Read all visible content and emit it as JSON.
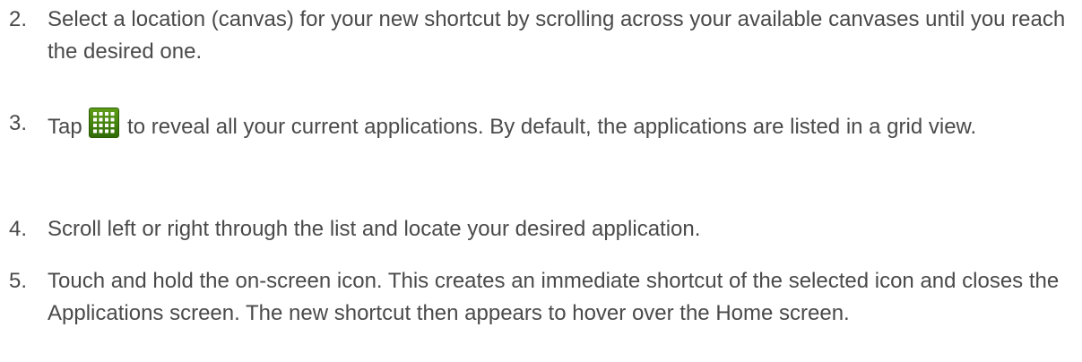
{
  "steps": [
    {
      "number": "2.",
      "text": "Select a location (canvas) for your new shortcut by scrolling across your available canvases until you reach the desired one."
    },
    {
      "number": "3.",
      "text_before": "Tap",
      "icon": "apps-grid-icon",
      "text_after": "to reveal all your current applications. By default, the applications are listed in a grid view."
    },
    {
      "number": "4.",
      "text": "Scroll left or right through the list and locate your desired application."
    },
    {
      "number": "5.",
      "text": "Touch and hold the on-screen icon. This creates an immediate shortcut of the selected icon and closes the Applications screen. The new shortcut then appears to hover over the Home screen."
    }
  ]
}
